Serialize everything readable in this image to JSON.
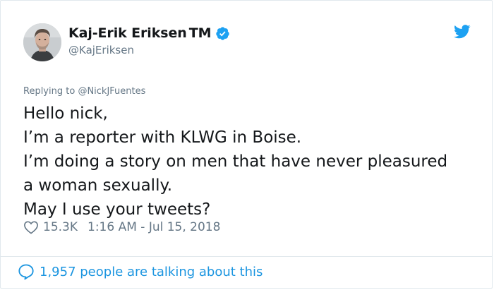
{
  "author": {
    "display_name": "Kaj-Erik Eriksen",
    "tm": "TM",
    "handle": "@KajEriksen",
    "verified": true
  },
  "reply": {
    "prefix": "Replying to ",
    "mention": "@NickJFuentes"
  },
  "tweet": {
    "lines": [
      "Hello nick,",
      "I’m a reporter with KLWG in Boise.",
      "I’m doing a story on men that have never pleasured",
      "a woman sexually.",
      "May I use your tweets?"
    ]
  },
  "meta": {
    "likes": "15.3K",
    "timestamp": "1:16 AM - Jul 15, 2018"
  },
  "footer": {
    "talking": "1,957 people are talking about this"
  },
  "colors": {
    "brand_blue": "#1da1f2",
    "link_blue": "#1b95e0",
    "muted_gray": "#657786",
    "text": "#14171a"
  },
  "icons": {
    "avatar": "avatar",
    "verified": "verified-badge-icon",
    "logo": "twitter-bird-icon",
    "like": "heart-outline-icon",
    "conversation": "speech-bubble-icon"
  }
}
